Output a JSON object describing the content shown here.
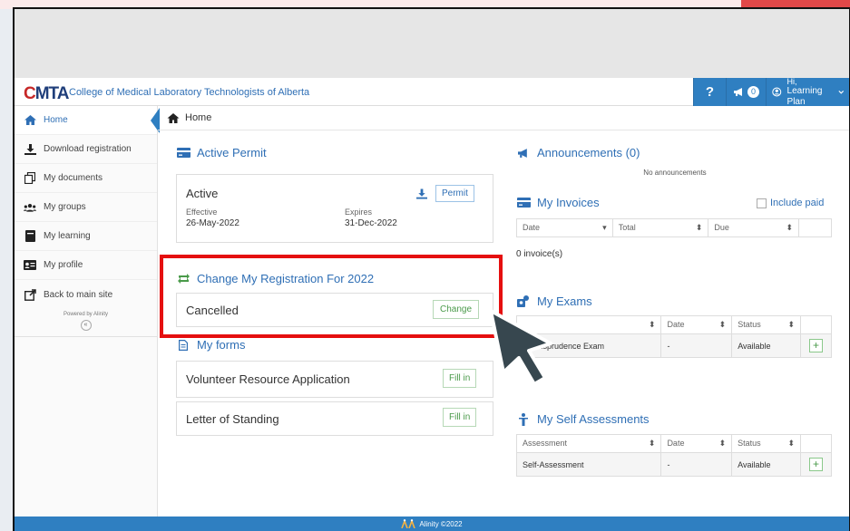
{
  "header": {
    "logo_c": "C",
    "logo_rest": "MTA",
    "org_name": "College of Medical Laboratory Technologists of Alberta",
    "help_label": "?",
    "announcement_count": "0",
    "greeting": "Hi,",
    "user_name": "Learning Plan"
  },
  "sidebar": {
    "items": [
      {
        "label": "Home",
        "icon": "home-icon"
      },
      {
        "label": "Download registration",
        "icon": "download-icon"
      },
      {
        "label": "My documents",
        "icon": "documents-icon"
      },
      {
        "label": "My groups",
        "icon": "groups-icon"
      },
      {
        "label": "My learning",
        "icon": "book-icon"
      },
      {
        "label": "My profile",
        "icon": "id-card-icon"
      },
      {
        "label": "Back to main site",
        "icon": "external-link-icon"
      }
    ],
    "powered_by": "Powered by Alinity",
    "collapse_label": "«"
  },
  "breadcrumb": {
    "label": "Home"
  },
  "active_permit": {
    "title": "Active Permit",
    "status": "Active",
    "effective_label": "Effective",
    "effective_date": "26-May-2022",
    "expires_label": "Expires",
    "expires_date": "31-Dec-2022",
    "permit_button": "Permit"
  },
  "change_registration": {
    "title": "Change My Registration For 2022",
    "status": "Cancelled",
    "change_button": "Change"
  },
  "my_forms": {
    "title": "My forms",
    "items": [
      {
        "label": "Volunteer Resource Application",
        "button": "Fill in"
      },
      {
        "label": "Letter of Standing",
        "button": "Fill in"
      }
    ]
  },
  "announcements": {
    "title": "Announcements (0)",
    "empty": "No announcements"
  },
  "invoices": {
    "title": "My Invoices",
    "include_paid": "Include paid",
    "columns": [
      "Date",
      "Total",
      "Due"
    ],
    "count_text": "0 invoice(s)"
  },
  "exams": {
    "title": "My Exams",
    "columns": [
      "",
      "Date",
      "Status"
    ],
    "rows": [
      {
        "name": "Jurisprudence Exam",
        "date": "-",
        "status": "Available"
      }
    ]
  },
  "self_assessments": {
    "title": "My Self Assessments",
    "columns": [
      "Assessment",
      "Date",
      "Status"
    ],
    "rows": [
      {
        "name": "Self-Assessment",
        "date": "-",
        "status": "Available"
      }
    ]
  },
  "footer": {
    "text": "Alinity ©2022"
  },
  "colors": {
    "accent": "#2f7fc1",
    "highlight": "#e50f0f",
    "success": "#4a9a4a"
  }
}
